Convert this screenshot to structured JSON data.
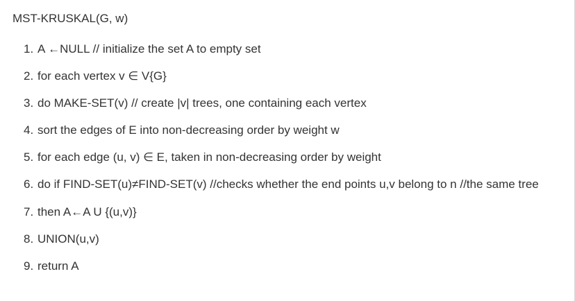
{
  "document": {
    "title": "MST-KRUSKAL(G, w)",
    "steps": [
      {
        "number": "1.",
        "text": "A ←NULL // initialize the set A to empty set"
      },
      {
        "number": "2.",
        "text": "for each vertex v ∈ V{G}"
      },
      {
        "number": "3.",
        "text": "do MAKE-SET(v) // create |v| trees, one containing each vertex"
      },
      {
        "number": "4.",
        "text": "sort the edges of E into non-decreasing order by weight w"
      },
      {
        "number": "5.",
        "text": "for each edge (u, v) ∈ E, taken in non-decreasing order by weight"
      },
      {
        "number": "6.",
        "text": "do if FIND-SET(u)≠FIND-SET(v) //checks whether the end points u,v belong to n //the same tree"
      },
      {
        "number": "7.",
        "text": "then A←A U {(u,v)}"
      },
      {
        "number": "8.",
        "text": "UNION(u,v)"
      },
      {
        "number": "9.",
        "text": "return A"
      }
    ]
  }
}
